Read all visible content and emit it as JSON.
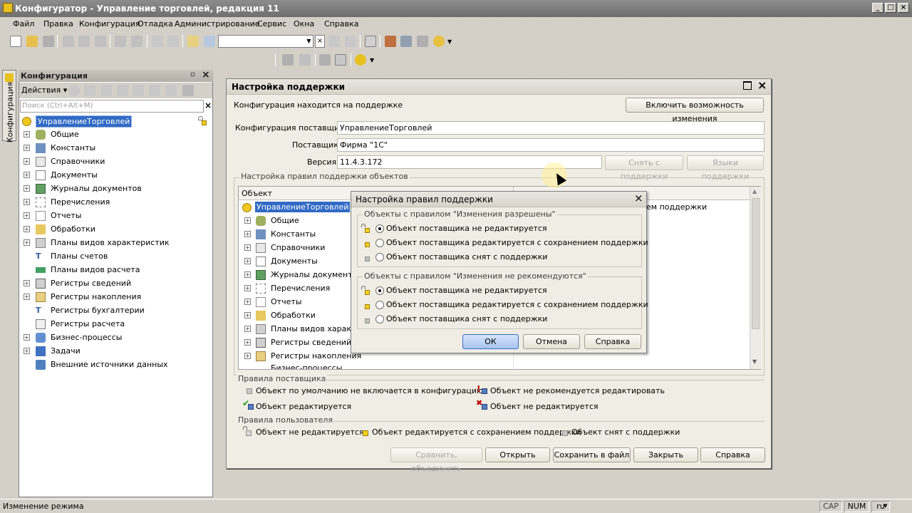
{
  "window": {
    "title": "Конфигуратор - Управление торговлей, редакция 11"
  },
  "menu": [
    "Файл",
    "Правка",
    "Конфигурация",
    "Отладка",
    "Администрирование",
    "Сервис",
    "Окна",
    "Справка"
  ],
  "config_panel": {
    "title": "Конфигурация",
    "side_tab": "Конфигурация",
    "actions_label": "Действия",
    "search_placeholder": "Поиск (Ctrl+Alt+M)",
    "root": "УправлениеТорговлей",
    "items": [
      "Общие",
      "Константы",
      "Справочники",
      "Документы",
      "Журналы документов",
      "Перечисления",
      "Отчеты",
      "Обработки",
      "Планы видов характеристик",
      "Планы счетов",
      "Планы видов расчета",
      "Регистры сведений",
      "Регистры накопления",
      "Регистры бухгалтерии",
      "Регистры расчета",
      "Бизнес-процессы",
      "Задачи",
      "Внешние источники данных"
    ]
  },
  "support_dialog": {
    "title": "Настройка поддержки",
    "status_text": "Конфигурация находится на поддержке",
    "enable_changes_button": "Включить возможность изменения",
    "vendor_config_label": "Конфигурация поставщика:",
    "vendor_config_value": "УправлениеТорговлей",
    "vendor_label": "Поставщик:",
    "vendor_value": "Фирма \"1С\"",
    "version_label": "Версия:",
    "version_value": "11.4.3.172",
    "remove_support_button": "Снять с поддержки",
    "languages_button": "Языки поддержки",
    "rules_group_title": "Настройка правил поддержки объектов",
    "table_header_object": "Объект",
    "table_root": "УправлениеТорговлей",
    "table_root_rule_partial": "ем поддержки",
    "table_items": [
      "Общие",
      "Константы",
      "Справочники",
      "Документы",
      "Журналы документов",
      "Перечисления",
      "Отчеты",
      "Обработки",
      "Планы видов характер",
      "Регистры сведений",
      "Регистры накопления",
      "Бизнес-процессы"
    ],
    "vendor_rules_title": "Правила поставщика",
    "vendor_rules": [
      "Объект по умолчанию не включается в конфигурацию",
      "Объект не рекомендуется редактировать",
      "Объект редактируется",
      "Объект не редактируется"
    ],
    "user_rules_title": "Правила пользователя",
    "user_rules": [
      "Объект не редактируется",
      "Объект редактируется с сохранением поддержки",
      "Объект снят с поддержки"
    ],
    "buttons": {
      "compare": "Сравнить, объединить",
      "open": "Открыть",
      "save": "Сохранить в файл",
      "close": "Закрыть",
      "help": "Справка"
    }
  },
  "rules_dialog": {
    "title": "Настройка правил поддержки",
    "group1_title": "Объекты с правилом \"Изменения разрешены\"",
    "group2_title": "Объекты с правилом \"Изменения не рекомендуются\"",
    "options": [
      "Объект поставщика не редактируется",
      "Объект поставщика редактируется с сохранением поддержки",
      "Объект поставщика снят с поддержки"
    ],
    "group1_selected": 0,
    "group2_selected": 0,
    "ok": "ОК",
    "cancel": "Отмена",
    "help": "Справка"
  },
  "statusbar": {
    "text": "Изменение режима",
    "cap": "CAP",
    "num": "NUM",
    "lang": "ru"
  },
  "colors": {
    "selection": "#316ac5",
    "title_bar": "#7a7a7a",
    "dialog_bg": "#f0ede4"
  }
}
